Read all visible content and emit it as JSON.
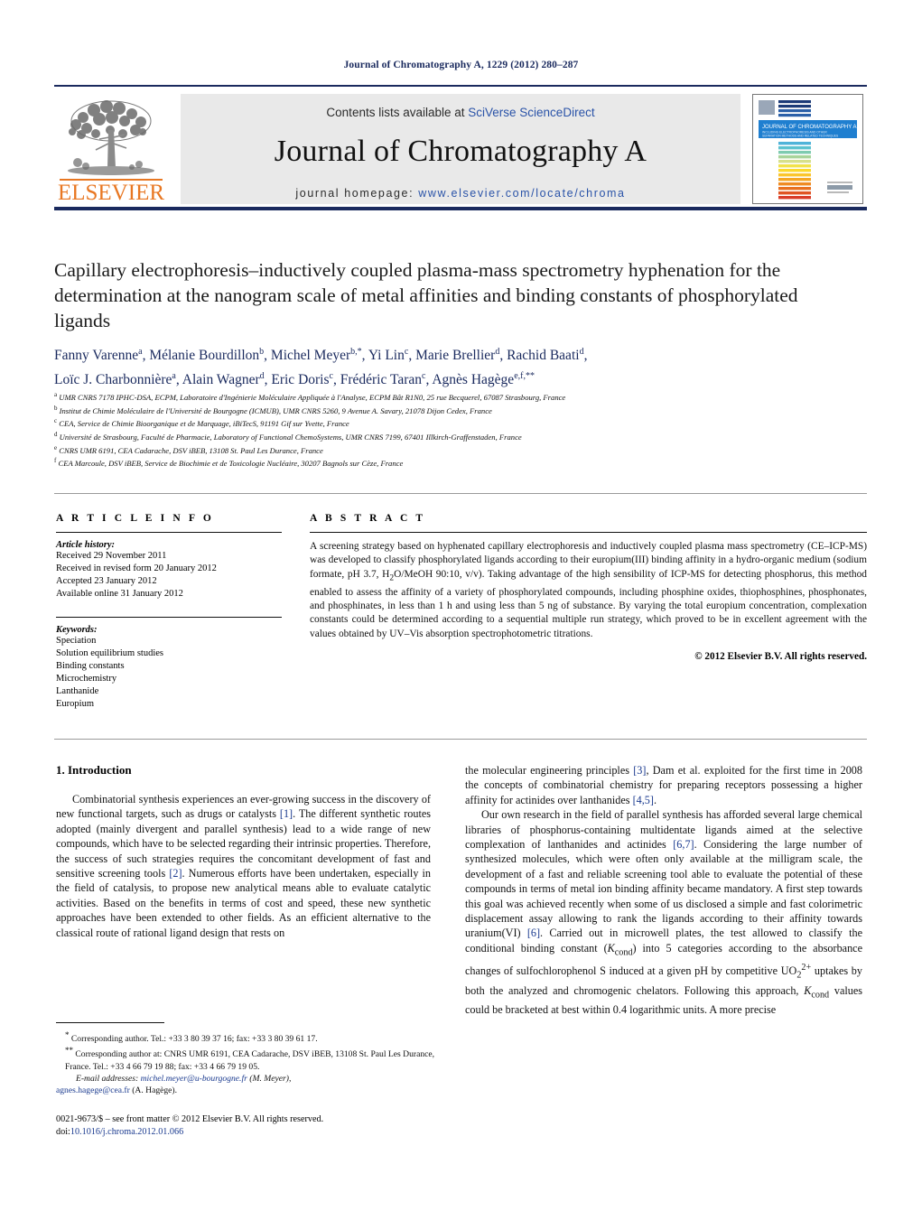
{
  "running_head": "Journal of Chromatography A, 1229 (2012) 280–287",
  "masthead": {
    "contents_prefix": "Contents lists available at ",
    "contents_link": "SciVerse ScienceDirect",
    "journal_name": "Journal of Chromatography A",
    "homepage_label": "journal homepage: ",
    "homepage_url": "www.elsevier.com/locate/chroma",
    "publisher": "ELSEVIER",
    "cover_title": "JOURNAL OF CHROMATOGRAPHY A",
    "cover_subtitle": "INCLUDING ELECTROPHORESIS AND OTHER SEPARATION METHODS AND RELATED TECHNIQUES"
  },
  "article": {
    "title": "Capillary electrophoresis–inductively coupled plasma-mass spectrometry hyphenation for the determination at the nanogram scale of metal affinities and binding constants of phosphorylated ligands",
    "authors_line1": "Fanny Varenne<sup>a</sup>, Mélanie Bourdillon<sup>b</sup>, Michel Meyer<sup>b,*</sup>, Yi Lin<sup>c</sup>, Marie Brellier<sup>d</sup>, Rachid Baati<sup>d</sup>,",
    "authors_line2": "Loïc J. Charbonnière<sup>a</sup>, Alain Wagner<sup>d</sup>, Eric Doris<sup>c</sup>, Frédéric Taran<sup>c</sup>, Agnès Hagège<sup>e,f,**</sup>",
    "affiliations": [
      "<sup>a</sup> UMR CNRS 7178 IPHC-DSA, ECPM, Laboratoire d'Ingénierie Moléculaire Appliquée à l'Analyse, ECPM Bât R1N0, 25 rue Becquerel, 67087 Strasbourg, France",
      "<sup>b</sup> Institut de Chimie Moléculaire de l'Université de Bourgogne (ICMUB), UMR CNRS 5260, 9 Avenue A. Savary, 21078 Dijon Cedex, France",
      "<sup>c</sup> CEA, Service de Chimie Bioorganique et de Marquage, iBiTecS, 91191 Gif sur Yvette, France",
      "<sup>d</sup> Université de Strasbourg, Faculté de Pharmacie, Laboratory of Functional ChemoSystems, UMR CNRS 7199, 67401 Illkirch-Graffenstaden, France",
      "<sup>e</sup> CNRS UMR 6191, CEA Cadarache, DSV iBEB, 13108 St. Paul Les Durance, France",
      "<sup>f</sup> CEA Marcoule, DSV iBEB, Service de Biochimie et de Toxicologie Nucléaire, 30207 Bagnols sur Cèze, France"
    ]
  },
  "article_info": {
    "heading": "A R T I C L E    I N F O",
    "history_label": "Article history:",
    "history": [
      "Received 29 November 2011",
      "Received in revised form 20 January 2012",
      "Accepted 23 January 2012",
      "Available online 31 January 2012"
    ],
    "keywords_label": "Keywords:",
    "keywords": [
      "Speciation",
      "Solution equilibrium studies",
      "Binding constants",
      "Microchemistry",
      "Lanthanide",
      "Europium"
    ]
  },
  "abstract": {
    "heading": "A B S T R A C T",
    "text": "A screening strategy based on hyphenated capillary electrophoresis and inductively coupled plasma mass spectrometry (CE–ICP-MS) was developed to classify phosphorylated ligands according to their europium(III) binding affinity in a hydro-organic medium (sodium formate, pH 3.7, H<sub>2</sub>O/MeOH 90:10, v/v). Taking advantage of the high sensibility of ICP-MS for detecting phosphorus, this method enabled to assess the affinity of a variety of phosphorylated compounds, including phosphine oxides, thiophosphines, phosphonates, and phosphinates, in less than 1 h and using less than 5 ng of substance. By varying the total europium concentration, complexation constants could be determined according to a sequential multiple run strategy, which proved to be in excellent agreement with the values obtained by UV–Vis absorption spectrophotometric titrations.",
    "copyright": "© 2012 Elsevier B.V. All rights reserved."
  },
  "body": {
    "section_heading": "1.  Introduction",
    "left_paragraphs": [
      "Combinatorial synthesis experiences an ever-growing success in the discovery of new functional targets, such as drugs or catalysts <span class=\"ref\">[1]</span>. The different synthetic routes adopted (mainly divergent and parallel synthesis) lead to a wide range of new compounds, which have to be selected regarding their intrinsic properties. Therefore, the success of such strategies requires the concomitant development of fast and sensitive screening tools <span class=\"ref\">[2]</span>. Numerous efforts have been undertaken, especially in the field of catalysis, to propose new analytical means able to evaluate catalytic activities. Based on the benefits in terms of cost and speed, these new synthetic approaches have been extended to other fields. As an efficient alternative to the classical route of rational ligand design that rests on"
    ],
    "right_paragraphs": [
      "the molecular engineering principles <span class=\"ref\">[3]</span>, Dam et al. exploited for the first time in 2008 the concepts of combinatorial chemistry for preparing receptors possessing a higher affinity for actinides over lanthanides <span class=\"ref\">[4,5]</span>.",
      "Our own research in the field of parallel synthesis has afforded several large chemical libraries of phosphorus-containing multidentate ligands aimed at the selective complexation of lanthanides and actinides <span class=\"ref\">[6,7]</span>. Considering the large number of synthesized molecules, which were often only available at the milligram scale, the development of a fast and reliable screening tool able to evaluate the potential of these compounds in terms of metal ion binding affinity became mandatory. A first step towards this goal was achieved recently when some of us disclosed a simple and fast colorimetric displacement assay allowing to rank the ligands according to their affinity towards uranium(VI) <span class=\"ref\">[6]</span>. Carried out in microwell plates, the test allowed to classify the conditional binding constant (<i>K</i><sub>cond</sub>) into 5 categories according to the absorbance changes of sulfochlorophenol S induced at a given pH by competitive UO<sub>2</sub><sup>2+</sup> uptakes by both the analyzed and chromogenic chelators. Following this approach, <i>K</i><sub>cond</sub> values could be bracketed at best within 0.4 logarithmic units. A more precise"
    ]
  },
  "footnotes": {
    "corresponding_1": "<sup>*</sup>  Corresponding author. Tel.: +33 3 80 39 37 16; fax: +33 3 80 39 61 17.",
    "corresponding_2": "<sup>**</sup>  Corresponding author at: CNRS UMR 6191, CEA Cadarache, DSV iBEB, 13108 St. Paul Les Durance, France. Tel.: +33 4 66 79 19 88; fax: +33 4 66 79 19 05.",
    "email_label": "E-mail addresses:",
    "email_1": "michel.meyer@u-bourgogne.fr",
    "email_1_owner": "(M. Meyer),",
    "email_2": "agnes.hagege@cea.fr",
    "email_2_owner": "(A. Hagège)."
  },
  "imprint": {
    "issn_line": "0021-9673/$ – see front matter © 2012 Elsevier B.V. All rights reserved.",
    "doi_prefix": "doi:",
    "doi": "10.1016/j.chroma.2012.01.066"
  },
  "colors": {
    "navy": "#1a2a5e",
    "link_blue": "#2a53a8",
    "elsevier_orange": "#E87722",
    "contents_bg": "#e9e9e9"
  }
}
